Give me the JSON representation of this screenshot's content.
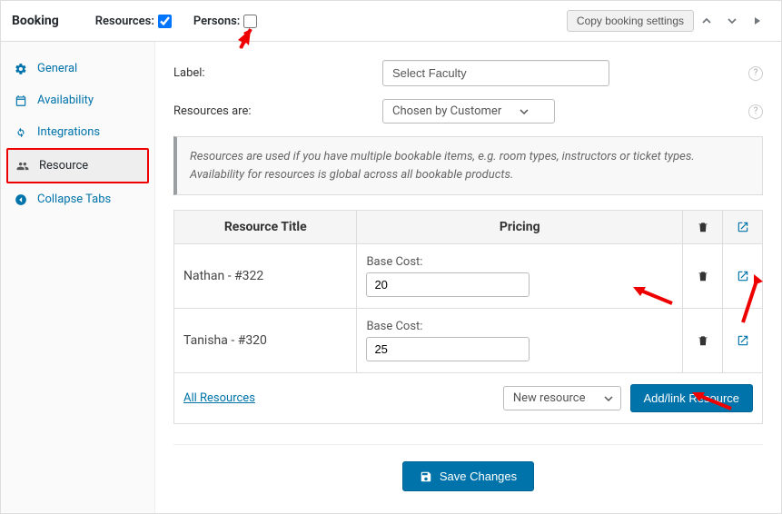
{
  "header": {
    "title": "Booking",
    "resources_label": "Resources:",
    "resources_checked": true,
    "persons_label": "Persons:",
    "persons_checked": false,
    "copy_btn": "Copy booking settings"
  },
  "sidebar": {
    "items": [
      {
        "label": "General",
        "icon": "gear"
      },
      {
        "label": "Availability",
        "icon": "calendar"
      },
      {
        "label": "Integrations",
        "icon": "refresh"
      },
      {
        "label": "Resource",
        "icon": "people",
        "active": true,
        "highlighted": true
      },
      {
        "label": "Collapse Tabs",
        "icon": "arrow-left"
      }
    ]
  },
  "form": {
    "label_field": {
      "label": "Label:",
      "value": "Select Faculty"
    },
    "resources_are": {
      "label": "Resources are:",
      "value": "Chosen by Customer"
    }
  },
  "info_box": "Resources are used if you have multiple bookable items, e.g. room types, instructors or ticket types. Availability for resources is global across all bookable products.",
  "table": {
    "headers": {
      "title": "Resource Title",
      "pricing": "Pricing"
    },
    "base_cost_label": "Base Cost:",
    "rows": [
      {
        "title": "Nathan - #322",
        "base_cost": "20"
      },
      {
        "title": "Tanisha - #320",
        "base_cost": "25"
      }
    ],
    "footer": {
      "all_resources": "All Resources",
      "new_resource": "New resource",
      "add_link": "Add/link Resource"
    }
  },
  "save_btn": "Save Changes"
}
